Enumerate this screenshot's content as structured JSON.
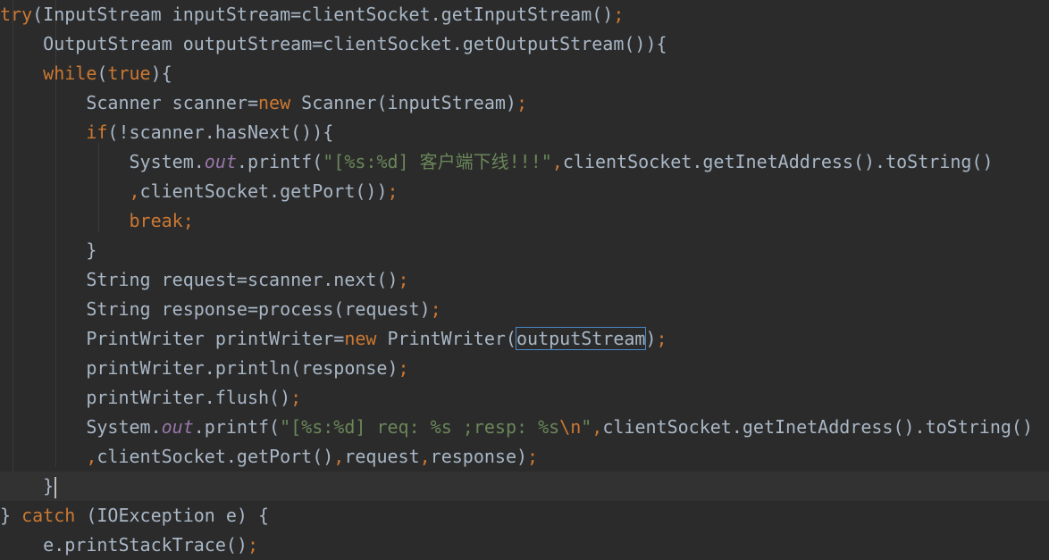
{
  "code_lines": [
    {
      "indent": "",
      "segments": [
        {
          "type": "kw",
          "text": "try"
        },
        {
          "type": "plain",
          "text": "(InputStream inputStream=clientSocket.getInputStream()"
        },
        {
          "type": "kw",
          "text": ";"
        }
      ]
    },
    {
      "indent": "    ",
      "segments": [
        {
          "type": "plain",
          "text": "OutputStream outputStream=clientSocket.getOutputStream()){"
        }
      ]
    },
    {
      "indent": "    ",
      "segments": [
        {
          "type": "kw",
          "text": "while"
        },
        {
          "type": "plain",
          "text": "("
        },
        {
          "type": "kw",
          "text": "true"
        },
        {
          "type": "plain",
          "text": "){"
        }
      ]
    },
    {
      "indent": "        ",
      "segments": [
        {
          "type": "plain",
          "text": "Scanner scanner="
        },
        {
          "type": "kw",
          "text": "new"
        },
        {
          "type": "plain",
          "text": " Scanner(inputStream)"
        },
        {
          "type": "kw",
          "text": ";"
        }
      ]
    },
    {
      "indent": "        ",
      "segments": [
        {
          "type": "kw",
          "text": "if"
        },
        {
          "type": "plain",
          "text": "(!scanner.hasNext()){"
        }
      ]
    },
    {
      "indent": "            ",
      "segments": [
        {
          "type": "plain",
          "text": "System."
        },
        {
          "type": "field",
          "text": "out"
        },
        {
          "type": "plain",
          "text": ".printf("
        },
        {
          "type": "str",
          "text": "\"[%s:%d] 客户端下线!!!\""
        },
        {
          "type": "kw",
          "text": ","
        },
        {
          "type": "plain",
          "text": "clientSocket.getInetAddress().toString()"
        }
      ]
    },
    {
      "indent": "            ",
      "segments": [
        {
          "type": "kw",
          "text": ","
        },
        {
          "type": "plain",
          "text": "clientSocket.getPort())"
        },
        {
          "type": "kw",
          "text": ";"
        }
      ]
    },
    {
      "indent": "            ",
      "segments": [
        {
          "type": "kw",
          "text": "break;"
        }
      ]
    },
    {
      "indent": "        ",
      "segments": [
        {
          "type": "plain",
          "text": "}"
        }
      ]
    },
    {
      "indent": "        ",
      "segments": [
        {
          "type": "plain",
          "text": "String request=scanner.next()"
        },
        {
          "type": "kw",
          "text": ";"
        }
      ]
    },
    {
      "indent": "        ",
      "segments": [
        {
          "type": "plain",
          "text": "String response=process(request)"
        },
        {
          "type": "kw",
          "text": ";"
        }
      ]
    },
    {
      "indent": "        ",
      "segments": [
        {
          "type": "plain",
          "text": "PrintWriter printWriter="
        },
        {
          "type": "kw",
          "text": "new"
        },
        {
          "type": "plain",
          "text": " PrintWriter("
        },
        {
          "type": "box",
          "text": "outputStream"
        },
        {
          "type": "plain",
          "text": ")"
        },
        {
          "type": "kw",
          "text": ";"
        }
      ]
    },
    {
      "indent": "        ",
      "segments": [
        {
          "type": "plain",
          "text": "printWriter.println(response)"
        },
        {
          "type": "kw",
          "text": ";"
        }
      ]
    },
    {
      "indent": "        ",
      "segments": [
        {
          "type": "plain",
          "text": "printWriter.flush()"
        },
        {
          "type": "kw",
          "text": ";"
        }
      ]
    },
    {
      "indent": "        ",
      "segments": [
        {
          "type": "plain",
          "text": "System."
        },
        {
          "type": "field",
          "text": "out"
        },
        {
          "type": "plain",
          "text": ".printf("
        },
        {
          "type": "str",
          "text": "\"[%s:%d] req: %s ;resp: %s"
        },
        {
          "type": "esc",
          "text": "\\n"
        },
        {
          "type": "str",
          "text": "\""
        },
        {
          "type": "kw",
          "text": ","
        },
        {
          "type": "plain",
          "text": "clientSocket.getInetAddress().toString()"
        }
      ]
    },
    {
      "indent": "        ",
      "segments": [
        {
          "type": "kw",
          "text": ","
        },
        {
          "type": "plain",
          "text": "clientSocket.getPort()"
        },
        {
          "type": "kw",
          "text": ","
        },
        {
          "type": "plain",
          "text": "request"
        },
        {
          "type": "kw",
          "text": ","
        },
        {
          "type": "plain",
          "text": "response)"
        },
        {
          "type": "kw",
          "text": ";"
        }
      ]
    },
    {
      "indent": "    ",
      "current": true,
      "segments": [
        {
          "type": "plain",
          "text": "}"
        },
        {
          "type": "caret",
          "text": ""
        }
      ]
    },
    {
      "indent": "",
      "segments": [
        {
          "type": "plain",
          "text": "} "
        },
        {
          "type": "kw",
          "text": "catch"
        },
        {
          "type": "plain",
          "text": " (IOException e) {"
        }
      ]
    },
    {
      "indent": "    ",
      "segments": [
        {
          "type": "plain",
          "text": "e.printStackTrace()"
        },
        {
          "type": "kw",
          "text": ";"
        }
      ]
    }
  ],
  "colors": {
    "background": "#2b2b2b",
    "current_line": "#323232",
    "keyword": "#cc7832",
    "string": "#6a8759",
    "field": "#9876aa",
    "plain": "#a9b7c6",
    "highlight_box": "#4a88c7"
  }
}
